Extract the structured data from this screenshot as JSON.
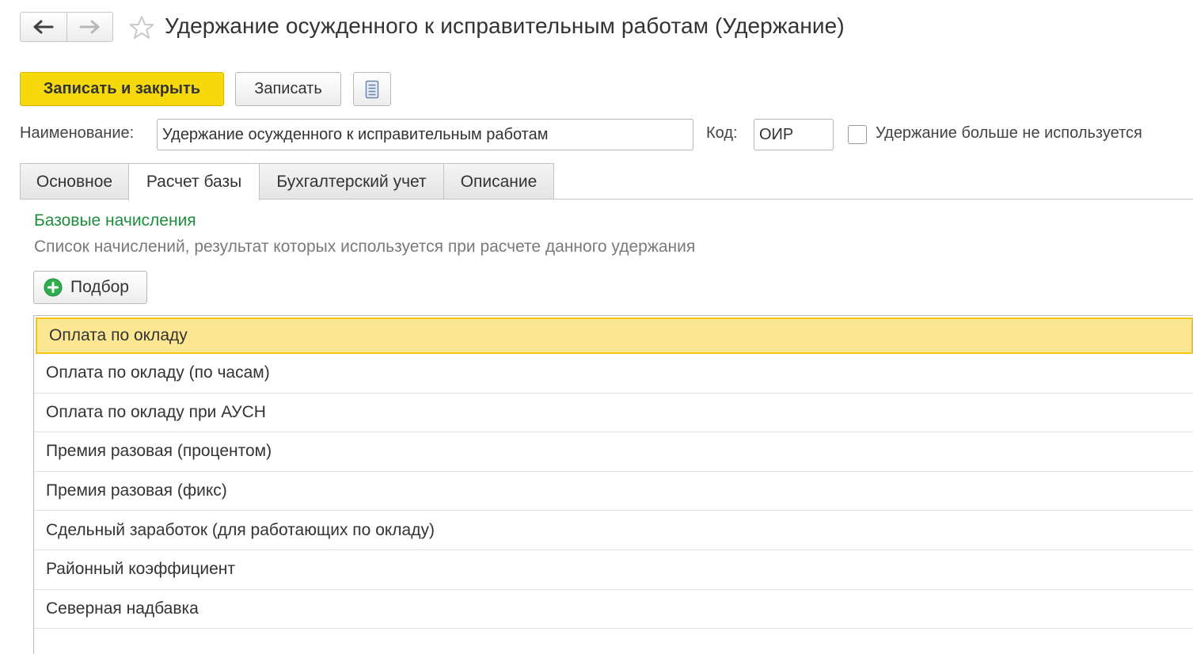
{
  "header": {
    "title": "Удержание осужденного к исправительным работам (Удержание)",
    "icons": {
      "back": "arrow-left-icon",
      "forward": "arrow-right-icon",
      "favorite": "star-icon"
    }
  },
  "toolbar": {
    "save_close_label": "Записать и закрыть",
    "save_label": "Записать",
    "doc_icon": "document-icon"
  },
  "form": {
    "name_label": "Наименование:",
    "name_value": "Удержание осужденного к исправительным работам",
    "code_label": "Код:",
    "code_value": "ОИР",
    "unused_label": "Удержание больше не используется",
    "unused_checked": false
  },
  "tabs": [
    {
      "label": "Основное",
      "active": false
    },
    {
      "label": "Расчет базы",
      "active": true
    },
    {
      "label": "Бухгалтерский учет",
      "active": false
    },
    {
      "label": "Описание",
      "active": false
    }
  ],
  "section": {
    "title": "Базовые начисления",
    "description": "Список начислений, результат которых используется при расчете данного удержания",
    "pick_label": "Подбор",
    "pick_icon": "plus-circle-icon"
  },
  "accruals": [
    {
      "label": "Оплата по окладу",
      "selected": true
    },
    {
      "label": "Оплата по окладу (по часам)",
      "selected": false
    },
    {
      "label": "Оплата по окладу при АУСН",
      "selected": false
    },
    {
      "label": "Премия разовая (процентом)",
      "selected": false
    },
    {
      "label": "Премия разовая (фикс)",
      "selected": false
    },
    {
      "label": "Сдельный заработок (для работающих по окладу)",
      "selected": false
    },
    {
      "label": "Районный коэффициент",
      "selected": false
    },
    {
      "label": "Северная надбавка",
      "selected": false
    }
  ],
  "colors": {
    "primary_button": "#f6d90b",
    "section_title": "#1e8e3e",
    "selected_row": "#fde792",
    "selected_border": "#f2c51a"
  }
}
